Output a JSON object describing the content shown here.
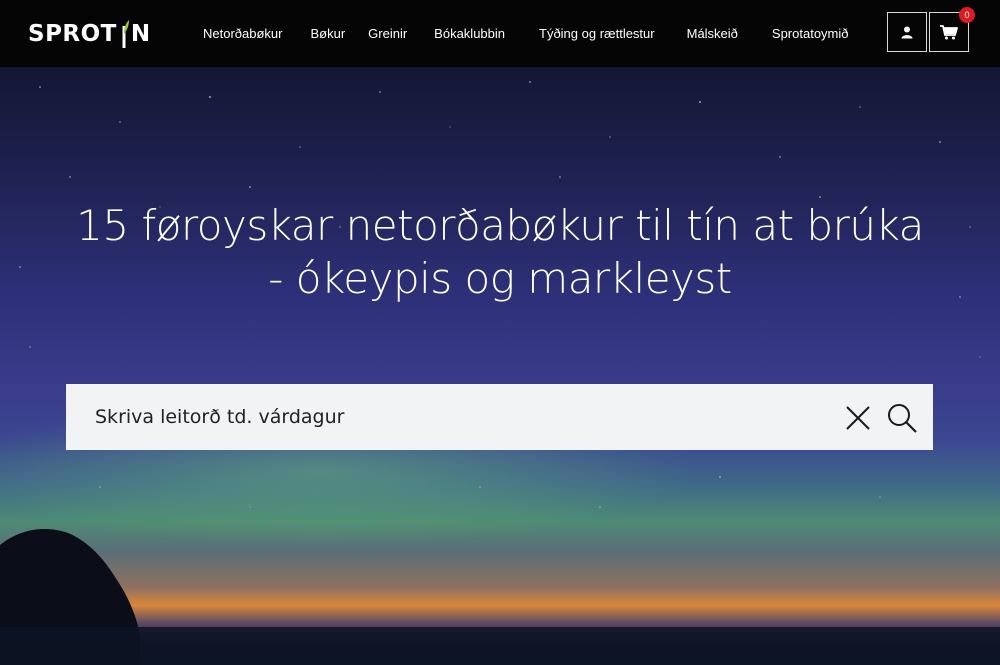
{
  "brand": {
    "logo_left": "SPROT",
    "logo_right": "N",
    "accent_color": "#9bc53d"
  },
  "nav": {
    "items": [
      {
        "label": "Netorðabøkur"
      },
      {
        "label": "Bøkur"
      },
      {
        "label": "Greinir"
      },
      {
        "label": "Bókaklubbin"
      },
      {
        "label": "Týðing og rættlestur"
      },
      {
        "label": "Málskeið"
      },
      {
        "label": "Sprotatoymið"
      }
    ]
  },
  "header_actions": {
    "account_icon": "user-icon",
    "cart_icon": "cart-icon",
    "cart_count": "0",
    "badge_color": "#e0191e"
  },
  "hero": {
    "headline_line1": "15 føroyskar netorðabøkur til tín at brúka",
    "headline_line2": "- ókeypis og markleyst"
  },
  "search": {
    "placeholder": "Skriva leitorð td. várdagur",
    "clear_icon": "close-icon",
    "search_icon": "search-icon"
  }
}
